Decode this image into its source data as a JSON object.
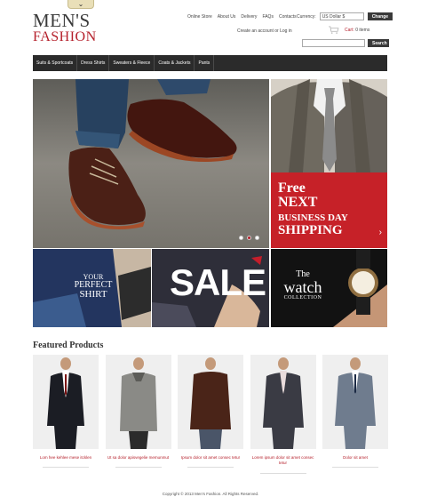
{
  "header": {
    "logo_line1": "MEN'S",
    "logo_line2": "FASHION",
    "links": [
      "Online Store",
      "About Us",
      "Delivery",
      "FAQs",
      "Contacts"
    ],
    "currency_label": "Currency:",
    "currency_value": "US Dollar $",
    "change_button": "Change",
    "account_text": "Create an account or Log in",
    "cart_label": "Cart:",
    "cart_count": "0 items",
    "search_placeholder": "",
    "search_button": "Search",
    "tab_icon": "chevron-down-icon"
  },
  "nav": [
    "Suits & Sportcoats",
    "Dress Shirts",
    "Sweaters & Fleece",
    "Coats & Jackets",
    "Pants"
  ],
  "promo": {
    "free_line1": "Free",
    "free_line2": "NEXT",
    "free_line3": "BUSINESS DAY",
    "free_line4": "SHIPPING"
  },
  "tiles": {
    "shirt_line1": "YOUR",
    "shirt_line2": "PERFECT",
    "shirt_line3": "SHIRT",
    "sale": "SALE",
    "watch_line1": "The",
    "watch_line2": "watch",
    "watch_line3": "COLLECTION"
  },
  "featured": {
    "title": "Featured Products",
    "products": [
      {
        "name": "Lom hee kehlee mese itcklen"
      },
      {
        "name": "Ut sa dolor apisvegelie memunmut"
      },
      {
        "name": "Ipsum dolor sit amet consec tetur"
      },
      {
        "name": "Lorem ipsum dolor sit amet consec tetur"
      },
      {
        "name": "Dolor sit amet"
      }
    ]
  },
  "footer": {
    "text": "Copyright © 2013 Men's Fashion. All Rights Reserved."
  },
  "colors": {
    "accent": "#b5202b",
    "nav_bg": "#2b2b2b",
    "promo_red": "#c62128"
  }
}
